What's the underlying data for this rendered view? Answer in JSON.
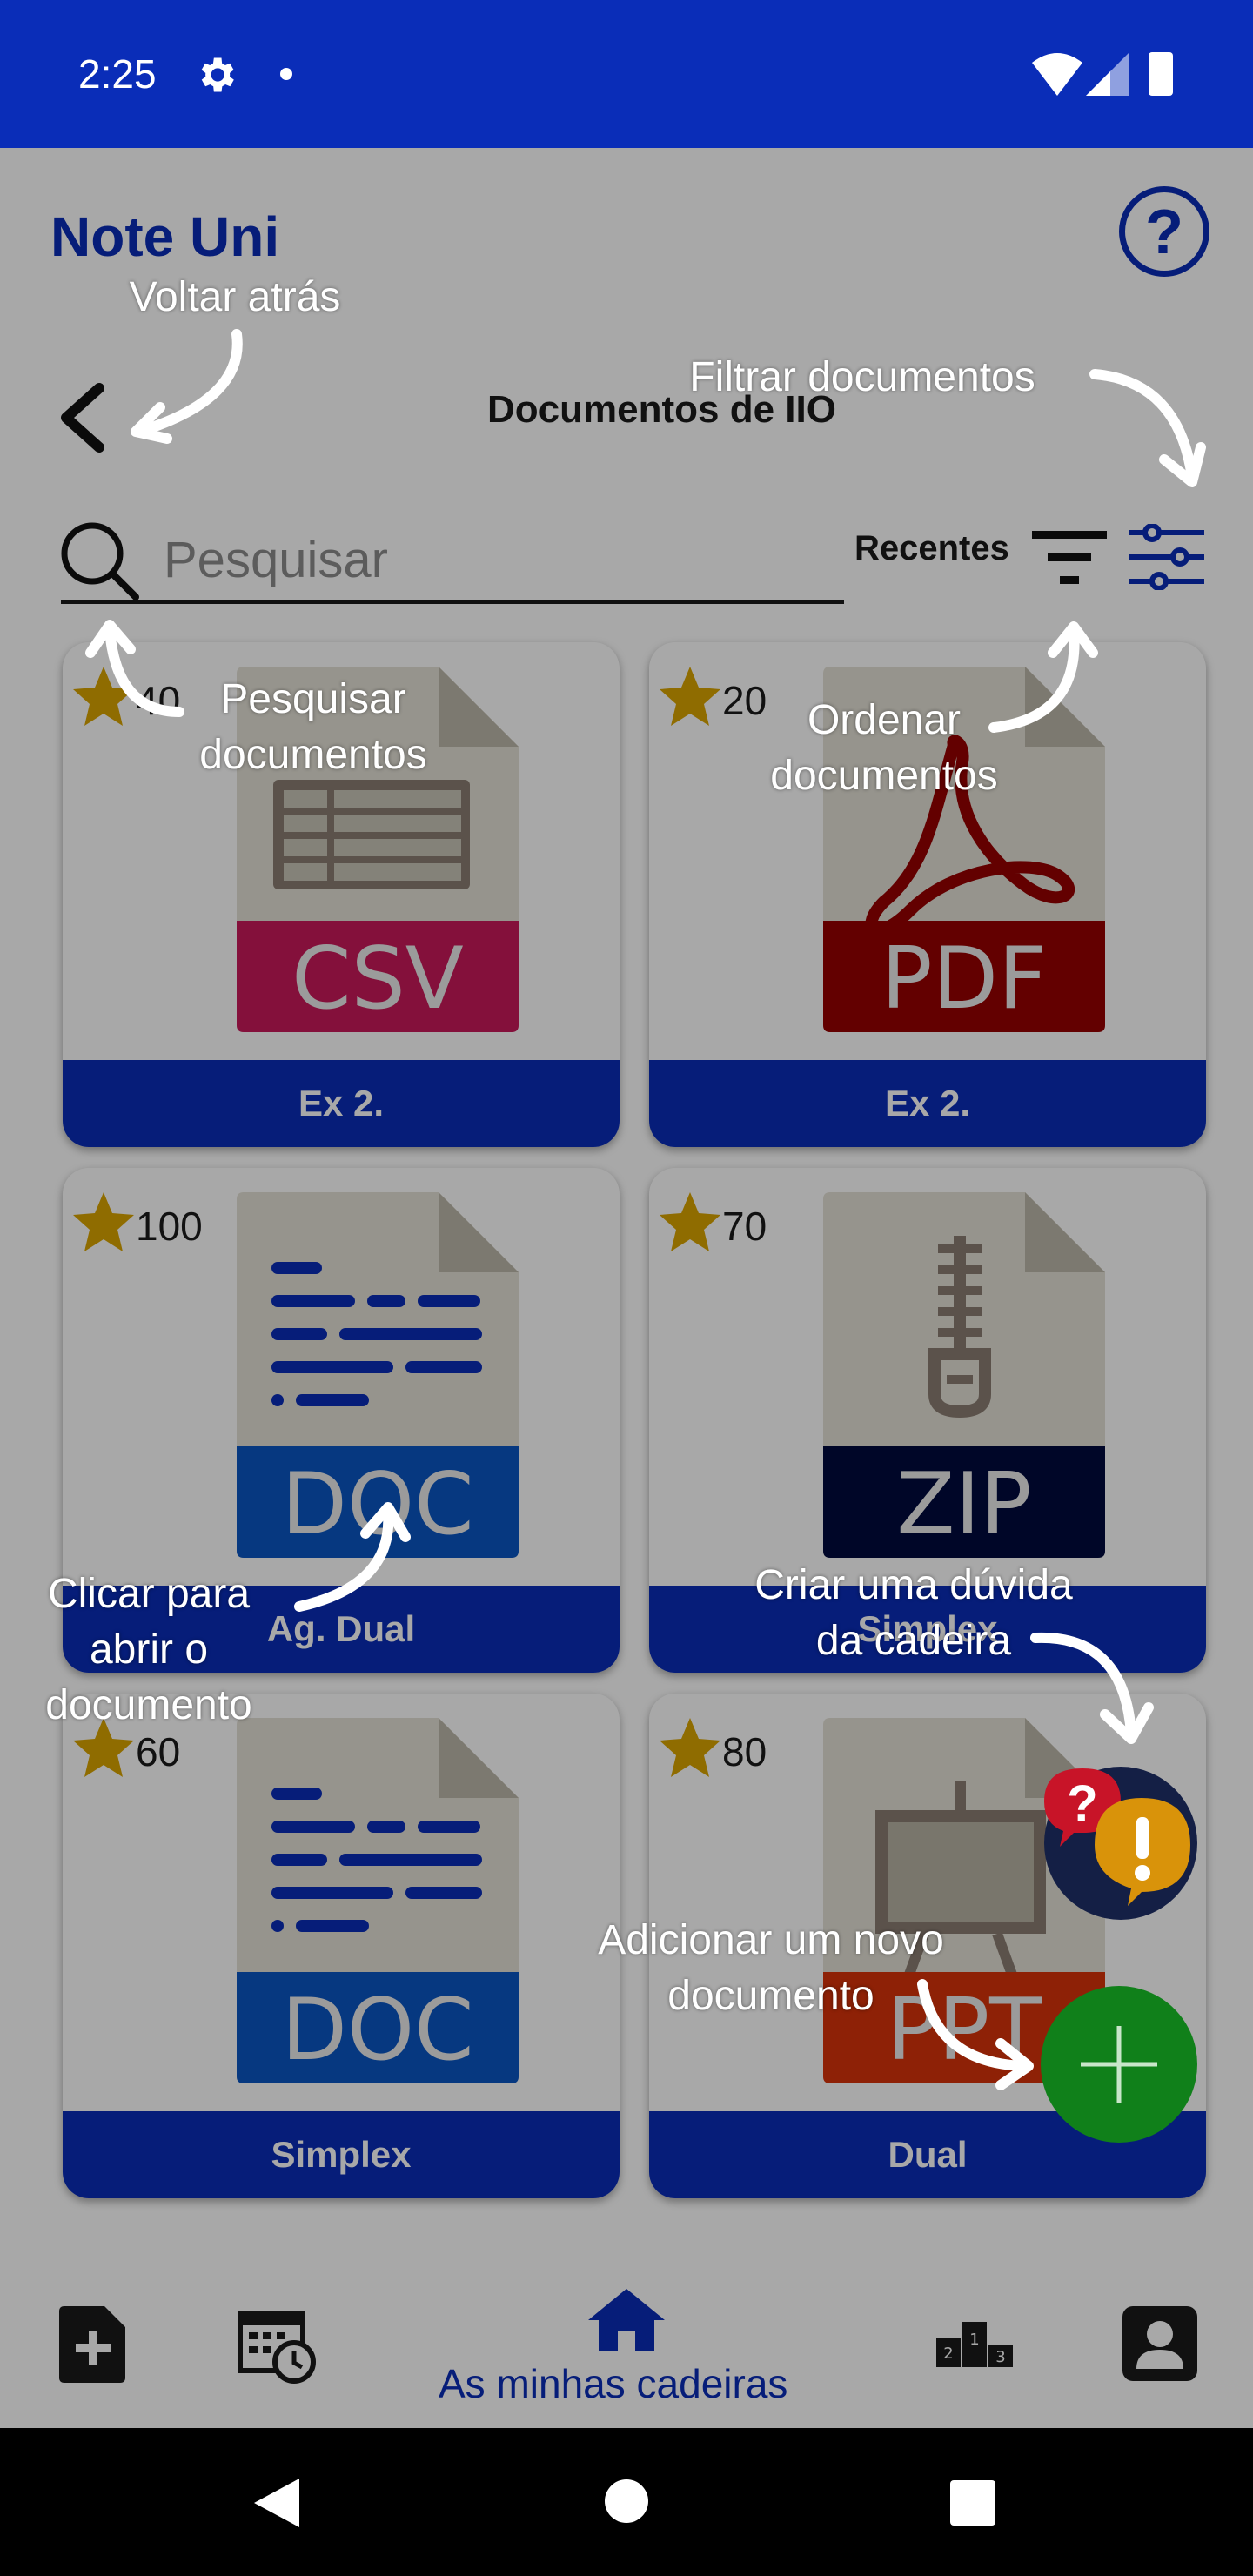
{
  "status_bar": {
    "time": "2:25"
  },
  "header": {
    "app_name": "Note Uni",
    "help_glyph": "?",
    "page_title": "Documentos de IIO"
  },
  "search": {
    "placeholder": "Pesquisar"
  },
  "sort": {
    "label": "Recentes"
  },
  "documents": [
    {
      "rating": "40",
      "name": "Ex 2.",
      "type": "CSV",
      "type_color": "#c8195a",
      "icon": "spreadsheet-icon"
    },
    {
      "rating": "20",
      "name": "Ex 2.",
      "type": "PDF",
      "type_color": "#960000",
      "icon": "acrobat-icon"
    },
    {
      "rating": "100",
      "name": "Ag. Dual",
      "type": "DOC",
      "type_color": "#0a56c2",
      "icon": "text-lines-icon"
    },
    {
      "rating": "70",
      "name": "Simplex",
      "type": "ZIP",
      "type_color": "#000a3e",
      "icon": "zipper-icon"
    },
    {
      "rating": "60",
      "name": "Simplex",
      "type": "DOC",
      "type_color": "#0a56c2",
      "icon": "text-lines-icon"
    },
    {
      "rating": "80",
      "name": "Dual",
      "type": "PPT",
      "type_color": "#d8330a",
      "icon": "presentation-icon"
    }
  ],
  "tutorial": {
    "back": "Voltar atrás",
    "filter": "Filtrar documentos",
    "search_l1": "Pesquisar",
    "search_l2": "documentos",
    "sort_l1": "Ordenar",
    "sort_l2": "documentos",
    "open_l1": "Clicar para",
    "open_l2": "abrir o",
    "open_l3": "documento",
    "doubt_l1": "Criar uma dúvida",
    "doubt_l2": "da cadeira",
    "add_l1": "Adicionar um novo",
    "add_l2": "documento"
  },
  "bottom_nav": {
    "active_label": "As minhas cadeiras"
  },
  "colors": {
    "primary": "#0a2db8",
    "star": "#d9a400",
    "add_fab": "#10801a"
  }
}
